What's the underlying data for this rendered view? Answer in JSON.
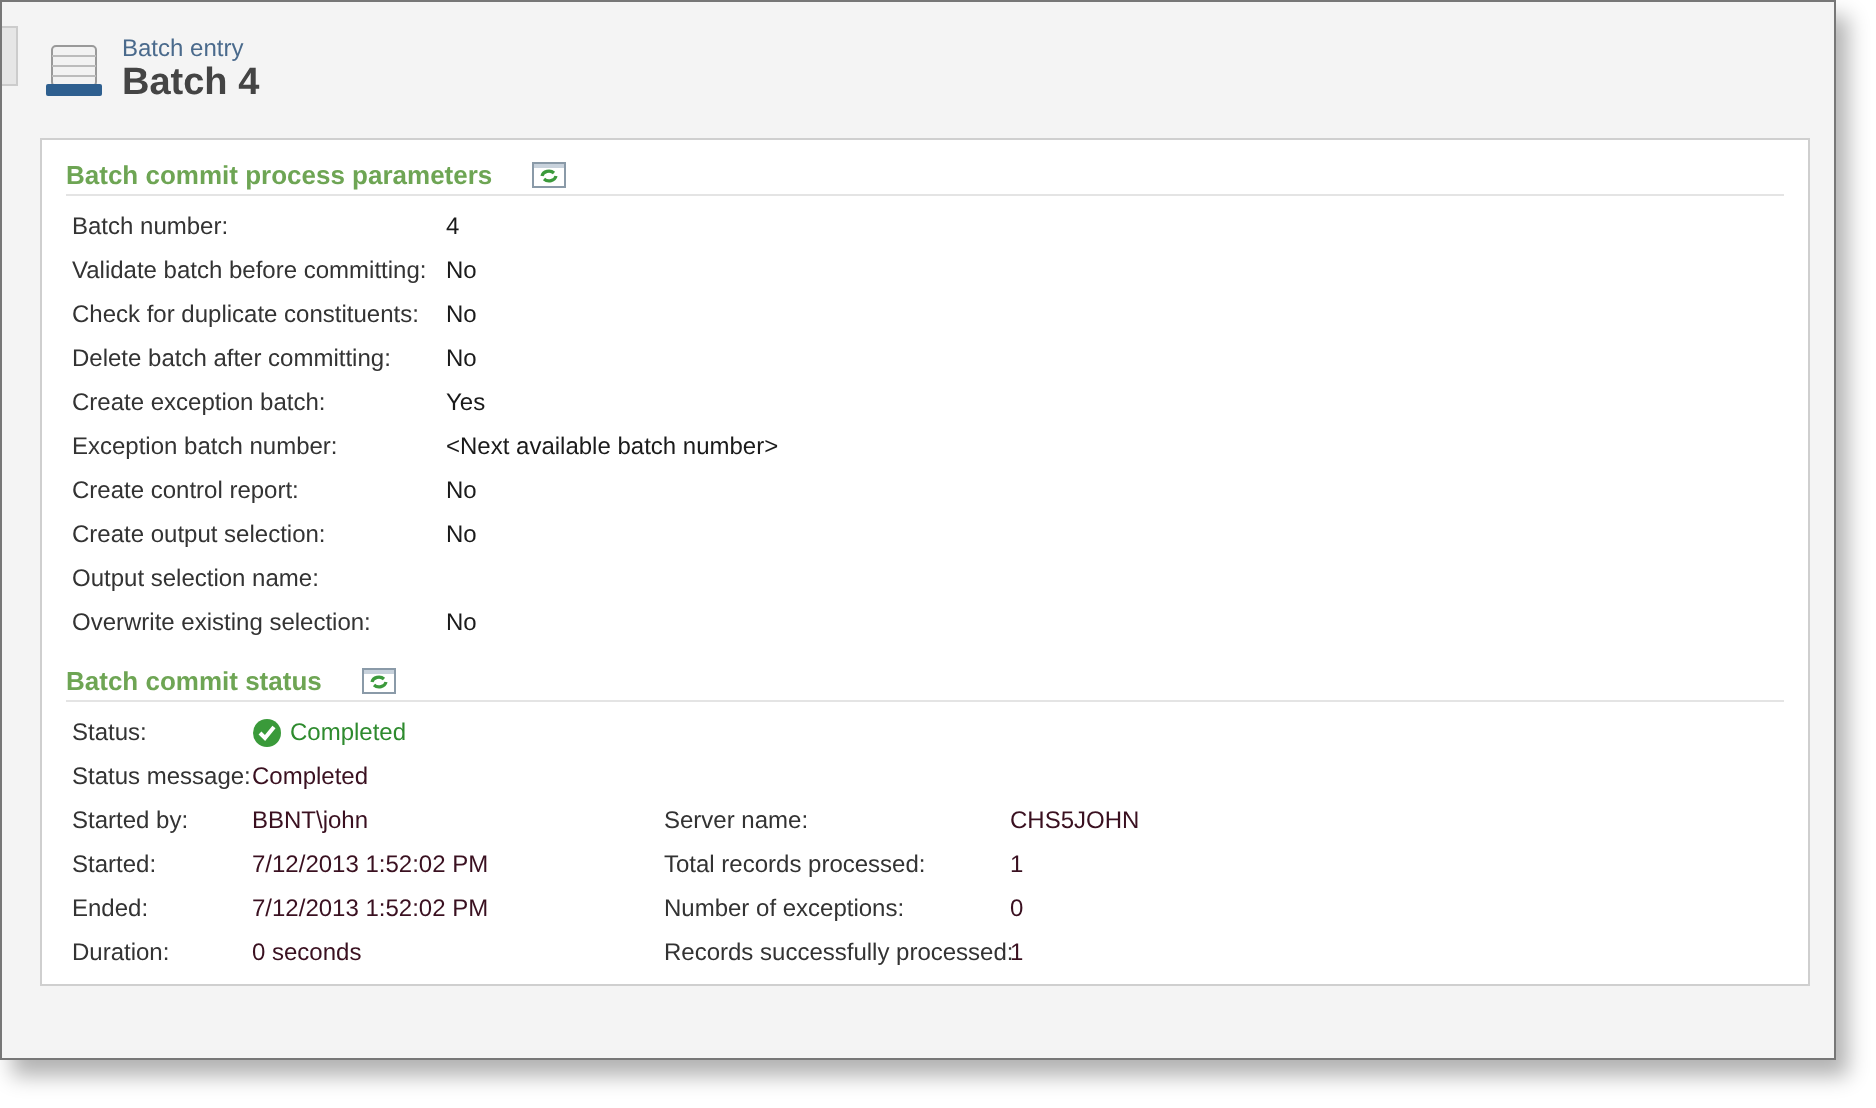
{
  "header": {
    "breadcrumb": "Batch entry",
    "title": "Batch 4"
  },
  "parameters": {
    "title": "Batch commit process parameters",
    "rows": [
      {
        "label": "Batch number:",
        "value": "4"
      },
      {
        "label": "Validate batch before committing:",
        "value": "No"
      },
      {
        "label": "Check for duplicate constituents:",
        "value": "No"
      },
      {
        "label": "Delete batch after committing:",
        "value": "No"
      },
      {
        "label": "Create exception batch:",
        "value": "Yes"
      },
      {
        "label": "Exception batch number:",
        "value": "<Next available batch number>"
      },
      {
        "label": "Create control report:",
        "value": "No"
      },
      {
        "label": "Create output selection:",
        "value": "No"
      },
      {
        "label": "Output selection name:",
        "value": ""
      },
      {
        "label": "Overwrite existing selection:",
        "value": "No"
      }
    ]
  },
  "status": {
    "title": "Batch commit status",
    "left": [
      {
        "label": "Status:",
        "value": "Completed",
        "kind": "status"
      },
      {
        "label": "Status message:",
        "value": "Completed",
        "kind": "text"
      },
      {
        "label": "Started by:",
        "value": "BBNT\\john",
        "kind": "text"
      },
      {
        "label": "Started:",
        "value": "7/12/2013 1:52:02 PM",
        "kind": "text"
      },
      {
        "label": "Ended:",
        "value": "7/12/2013 1:52:02 PM",
        "kind": "text"
      },
      {
        "label": "Duration:",
        "value": "0 seconds",
        "kind": "text"
      }
    ],
    "right": [
      {
        "label": "Server name:",
        "value": "CHS5JOHN"
      },
      {
        "label": "Total records processed:",
        "value": "1"
      },
      {
        "label": "Number of exceptions:",
        "value": "0"
      },
      {
        "label": "Records successfully processed:",
        "value": "1"
      }
    ]
  }
}
